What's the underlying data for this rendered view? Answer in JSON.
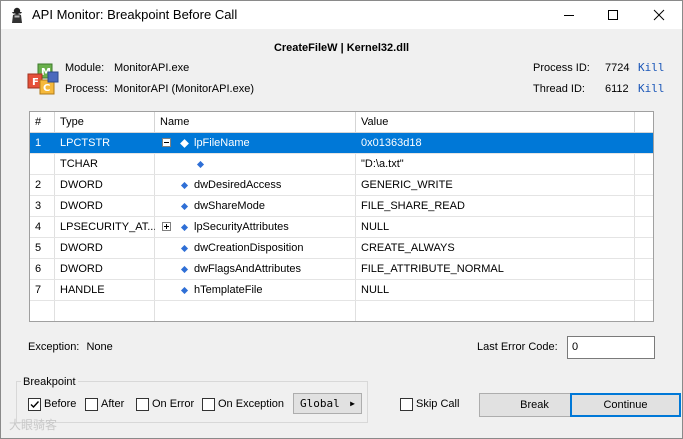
{
  "window": {
    "title": "API Monitor: Breakpoint Before Call"
  },
  "header": {
    "function_title": "CreateFileW | Kernel32.dll",
    "module_label": "Module:",
    "module_value": "MonitorAPI.exe",
    "process_label": "Process:",
    "process_value": "MonitorAPI (MonitorAPI.exe)",
    "process_id_label": "Process ID:",
    "process_id_value": "7724",
    "thread_id_label": "Thread ID:",
    "thread_id_value": "6112",
    "kill_label": "Kill"
  },
  "grid": {
    "columns": [
      "#",
      "Type",
      "Name",
      "Value"
    ],
    "rows": [
      {
        "num": "1",
        "type": "LPCTSTR",
        "name": "lpFileName",
        "value": "0x01363d18",
        "toggle": "−",
        "selected": true
      },
      {
        "num": "",
        "type": "TCHAR",
        "name": "",
        "value": "\"D:\\a.txt\"",
        "toggle": "",
        "selected": false
      },
      {
        "num": "2",
        "type": "DWORD",
        "name": "dwDesiredAccess",
        "value": "GENERIC_WRITE",
        "toggle": "",
        "selected": false
      },
      {
        "num": "3",
        "type": "DWORD",
        "name": "dwShareMode",
        "value": "FILE_SHARE_READ",
        "toggle": "",
        "selected": false
      },
      {
        "num": "4",
        "type": "LPSECURITY_AT...",
        "name": "lpSecurityAttributes",
        "value": "NULL",
        "toggle": "+",
        "selected": false
      },
      {
        "num": "5",
        "type": "DWORD",
        "name": "dwCreationDisposition",
        "value": "CREATE_ALWAYS",
        "toggle": "",
        "selected": false
      },
      {
        "num": "6",
        "type": "DWORD",
        "name": "dwFlagsAndAttributes",
        "value": "FILE_ATTRIBUTE_NORMAL",
        "toggle": "",
        "selected": false
      },
      {
        "num": "7",
        "type": "HANDLE",
        "name": "hTemplateFile",
        "value": "NULL",
        "toggle": "",
        "selected": false
      }
    ]
  },
  "exception": {
    "label": "Exception:",
    "value": "None",
    "last_error_label": "Last Error Code:",
    "last_error_value": "0"
  },
  "breakpoint": {
    "group_title": "Breakpoint",
    "before_label": "Before",
    "before_checked": true,
    "after_label": "After",
    "after_checked": false,
    "on_error_label": "On Error",
    "on_error_checked": false,
    "on_exception_label": "On Exception",
    "on_exception_checked": false,
    "global_label": "Global",
    "skip_call_label": "Skip Call",
    "skip_call_checked": false
  },
  "buttons": {
    "break_label": "Break",
    "continue_label": "Continue"
  },
  "watermark": {
    "text": "大眼骑客"
  },
  "colors": {
    "selection": "#0078d7",
    "link": "#1a56b8",
    "diamond": "#2f6fd6"
  }
}
